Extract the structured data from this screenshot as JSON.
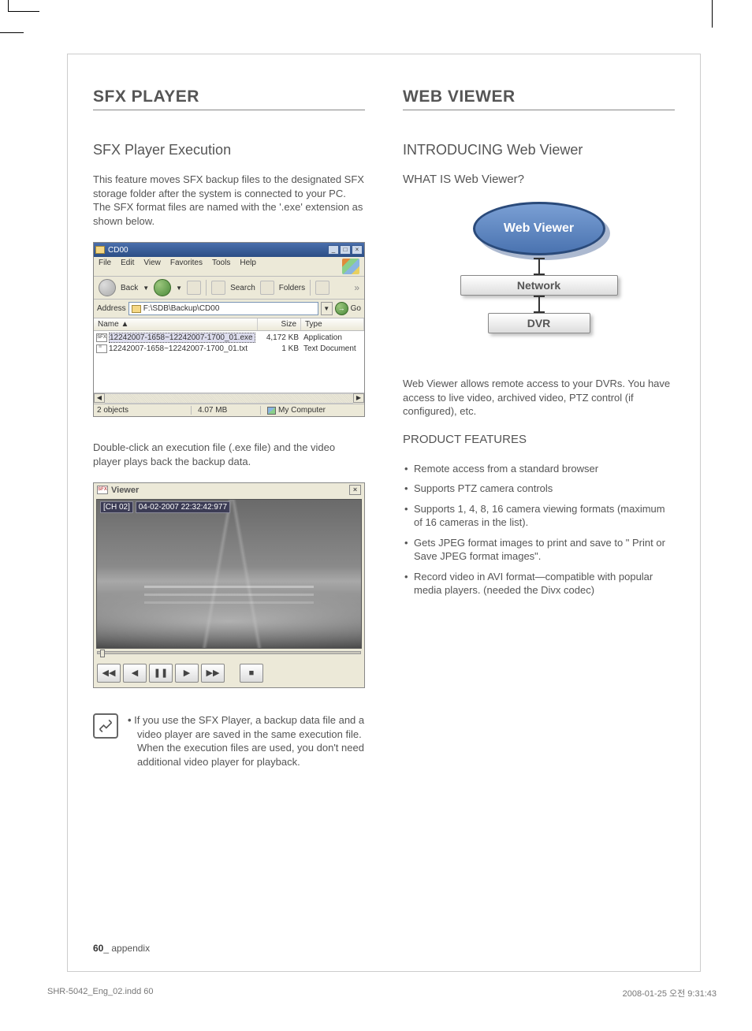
{
  "left": {
    "h1": "SFX PLAYER",
    "h2": "SFX Player Execution",
    "p1": "This feature moves SFX backup files to the designated SFX storage folder after the system is connected to your PC. The SFX format files are named with the '.exe' extension as shown below.",
    "explorer": {
      "title": "CD00",
      "menu": [
        "File",
        "Edit",
        "View",
        "Favorites",
        "Tools",
        "Help"
      ],
      "back": "Back",
      "search_label": "Search",
      "folders_label": "Folders",
      "address_label": "Address",
      "address": "F:\\SDB\\Backup\\CD00",
      "go": "Go",
      "headers": {
        "name": "Name  ▲",
        "size": "Size",
        "type": "Type"
      },
      "rows": [
        {
          "icon": "SFX",
          "name": "12242007-1658~12242007-1700_01.exe",
          "size": "4,172 KB",
          "type": "Application"
        },
        {
          "icon": "txt",
          "name": "12242007-1658~12242007-1700_01.txt",
          "size": "1 KB",
          "type": "Text Document"
        }
      ],
      "status": {
        "objects": "2 objects",
        "size": "4.07 MB",
        "location": "My Computer"
      }
    },
    "p2": "Double-click an execution file (.exe file) and the video player plays back the backup data.",
    "viewer": {
      "title": "Viewer",
      "osd_ch": "[CH 02]",
      "osd_ts": "04-02-2007 22:32:42:977",
      "buttons": [
        "◀◀",
        "◀",
        "❚❚",
        "▶",
        "▶▶",
        "■"
      ]
    },
    "note": "If you use the SFX Player, a backup data file and a video player are saved in the same execution file. When the execution files are used, you don't need additional video player for playback."
  },
  "right": {
    "h1": "WEB VIEWER",
    "h2": "INTRODUCING Web Viewer",
    "h3a": "WHAT IS Web Viewer?",
    "diagram": {
      "top": "Web Viewer",
      "mid": "Network",
      "bot": "DVR"
    },
    "p1": "Web Viewer allows remote access to your DVRs. You have access to live video, archived video, PTZ control (if configured), etc.",
    "h3b": "PRODUCT FEATURES",
    "features": [
      "Remote access from a standard browser",
      "Supports PTZ camera controls",
      "Supports 1, 4, 8, 16 camera viewing formats (maximum of 16 cameras in the list).",
      "Gets JPEG format images to print and save to \" Print or Save JPEG format images\".",
      "Record video in AVI format—compatible with popular media players. (needed the Divx codec)"
    ]
  },
  "footer": {
    "num": "60",
    "section": "_ appendix"
  },
  "print": {
    "file": "SHR-5042_Eng_02.indd   60",
    "stamp": "2008-01-25   오전 9:31:43"
  }
}
